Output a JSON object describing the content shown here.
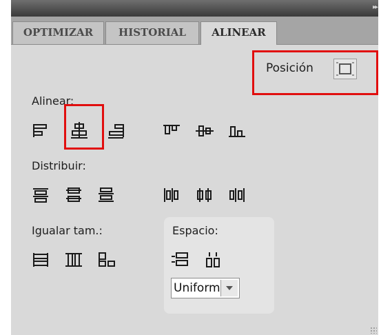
{
  "tabs": [
    {
      "label": "OPTIMIZAR",
      "active": false
    },
    {
      "label": "HISTORIAL",
      "active": false
    },
    {
      "label": "ALINEAR",
      "active": true
    }
  ],
  "position": {
    "label": "Posición",
    "icon": "position-frame-icon"
  },
  "align": {
    "label": "Alinear:",
    "buttons": [
      "align-left-edge-icon",
      "align-horizontal-center-icon",
      "align-right-edge-icon",
      "align-top-edge-icon",
      "align-vertical-center-icon",
      "align-bottom-edge-icon"
    ]
  },
  "distribute": {
    "label": "Distribuir:",
    "buttons": [
      "distribute-top-icon",
      "distribute-vertical-center-icon",
      "distribute-bottom-icon",
      "distribute-left-icon",
      "distribute-horizontal-center-icon",
      "distribute-right-icon"
    ]
  },
  "match_size": {
    "label": "Igualar tam.:",
    "buttons": [
      "match-width-icon",
      "match-height-icon",
      "match-width-and-height-icon"
    ]
  },
  "spacing": {
    "label": "Espacio:",
    "buttons": [
      "space-evenly-vertical-icon",
      "space-evenly-horizontal-icon"
    ],
    "select_value": "Uniforme"
  },
  "highlight_color": "#e10e0e"
}
